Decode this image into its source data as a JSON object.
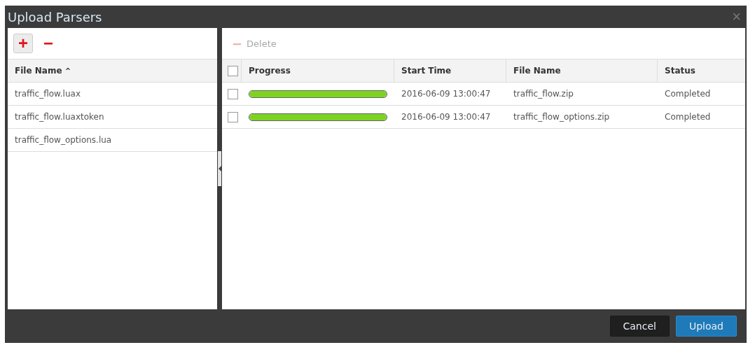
{
  "window": {
    "title": "Upload Parsers",
    "close": "×"
  },
  "parsers": {
    "toolbar": {
      "add": "+",
      "remove": "−"
    },
    "sort_column": {
      "label": "File Name",
      "sort": "^"
    },
    "rows": [
      {
        "file_name": "traffic_flow.luax"
      },
      {
        "file_name": "traffic_flow.luaxtoken"
      },
      {
        "file_name": "traffic_flow_options.lua"
      }
    ]
  },
  "uploads": {
    "toolbar": {
      "delete": {
        "icon": "−",
        "label": "Delete",
        "disabled": true
      }
    },
    "select_all": {
      "checked": false
    },
    "columns": [
      "Progress",
      "Start Time",
      "File Name",
      "Status"
    ],
    "rows": [
      {
        "checked": false,
        "level": 1,
        "start_time": "2016-06-09 13:00:47",
        "file_name": "traffic_flow.zip",
        "status": "Completed"
      },
      {
        "checked": false,
        "level": 1,
        "start_time": "2016-06-09 13:00:47",
        "file_name": "traffic_flow_options.zip",
        "status": "Completed"
      }
    ]
  },
  "buttons": [
    {
      "label": "Cancel",
      "kind": "secondary"
    },
    {
      "label": "Upload",
      "kind": "primary"
    }
  ]
}
